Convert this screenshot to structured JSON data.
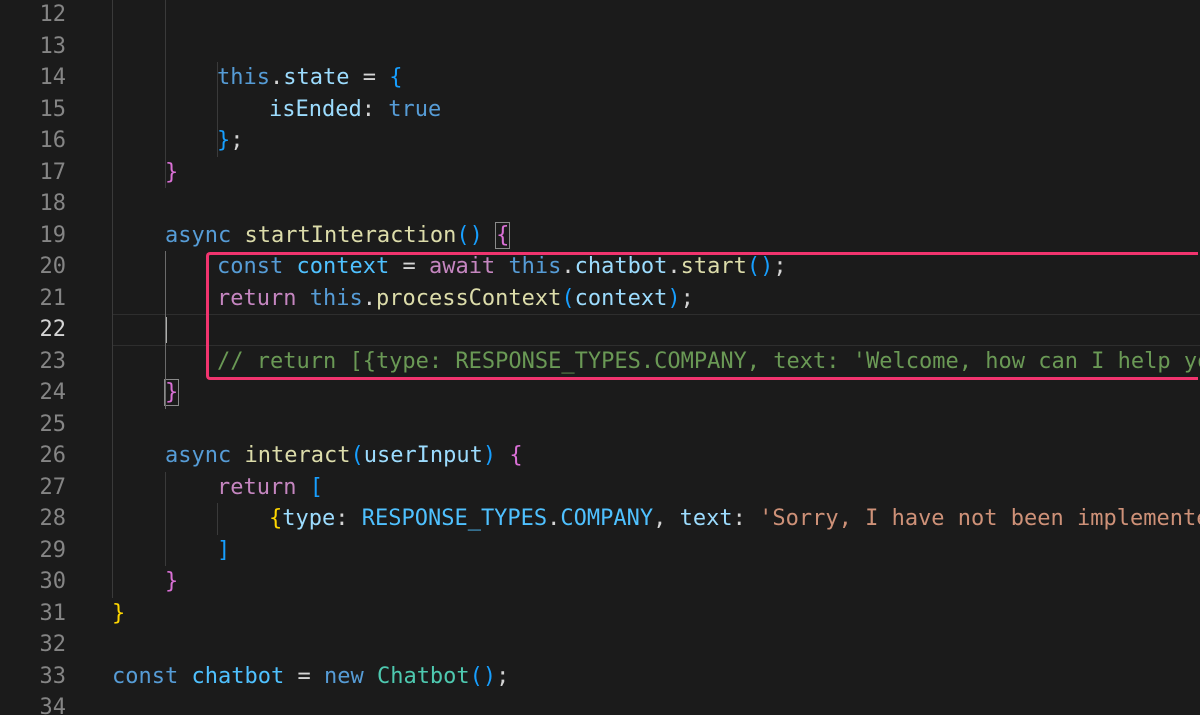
{
  "editor": {
    "active_line": "22",
    "lines": [
      {
        "num": "12",
        "tokens": []
      },
      {
        "num": "13",
        "tokens": []
      },
      {
        "num": "14",
        "tokens": [
          {
            "t": "this",
            "c": "th"
          },
          {
            "t": ".",
            "c": "op"
          },
          {
            "t": "state",
            "c": "prop"
          },
          {
            "t": " = ",
            "c": "op"
          },
          {
            "t": "{",
            "c": "b3"
          }
        ]
      },
      {
        "num": "15",
        "tokens": [
          {
            "t": "isEnded",
            "c": "prop"
          },
          {
            "t": ": ",
            "c": "op"
          },
          {
            "t": "true",
            "c": "kw"
          }
        ]
      },
      {
        "num": "16",
        "tokens": [
          {
            "t": "}",
            "c": "b3"
          },
          {
            "t": ";",
            "c": "op"
          }
        ]
      },
      {
        "num": "17",
        "tokens": [
          {
            "t": "}",
            "c": "b2"
          }
        ]
      },
      {
        "num": "18",
        "tokens": []
      },
      {
        "num": "19",
        "tokens": [
          {
            "t": "async",
            "c": "kw"
          },
          {
            "t": " ",
            "c": "op"
          },
          {
            "t": "startInteraction",
            "c": "fn"
          },
          {
            "t": "()",
            "c": "b3"
          },
          {
            "t": " ",
            "c": "op"
          },
          {
            "t": "{",
            "c": "b2 bracket-box"
          }
        ]
      },
      {
        "num": "20",
        "tokens": [
          {
            "t": "const",
            "c": "kw"
          },
          {
            "t": " ",
            "c": "op"
          },
          {
            "t": "context",
            "c": "var"
          },
          {
            "t": " = ",
            "c": "op"
          },
          {
            "t": "await",
            "c": "kwc"
          },
          {
            "t": " ",
            "c": "op"
          },
          {
            "t": "this",
            "c": "th"
          },
          {
            "t": ".",
            "c": "op"
          },
          {
            "t": "chatbot",
            "c": "prop"
          },
          {
            "t": ".",
            "c": "op"
          },
          {
            "t": "start",
            "c": "fn"
          },
          {
            "t": "()",
            "c": "b3"
          },
          {
            "t": ";",
            "c": "op"
          }
        ]
      },
      {
        "num": "21",
        "tokens": [
          {
            "t": "return",
            "c": "kwc"
          },
          {
            "t": " ",
            "c": "op"
          },
          {
            "t": "this",
            "c": "th"
          },
          {
            "t": ".",
            "c": "op"
          },
          {
            "t": "processContext",
            "c": "fn"
          },
          {
            "t": "(",
            "c": "b3"
          },
          {
            "t": "context",
            "c": "prop"
          },
          {
            "t": ")",
            "c": "b3"
          },
          {
            "t": ";",
            "c": "op"
          }
        ]
      },
      {
        "num": "22",
        "tokens": []
      },
      {
        "num": "23",
        "tokens": [
          {
            "t": "// return [{type: RESPONSE_TYPES.COMPANY, text: 'Welcome, how can I help yo",
            "c": "cmt"
          }
        ]
      },
      {
        "num": "24",
        "tokens": [
          {
            "t": "}",
            "c": "b2 bracket-box"
          }
        ]
      },
      {
        "num": "25",
        "tokens": []
      },
      {
        "num": "26",
        "tokens": [
          {
            "t": "async",
            "c": "kw"
          },
          {
            "t": " ",
            "c": "op"
          },
          {
            "t": "interact",
            "c": "fn"
          },
          {
            "t": "(",
            "c": "b3"
          },
          {
            "t": "userInput",
            "c": "prop"
          },
          {
            "t": ")",
            "c": "b3"
          },
          {
            "t": " ",
            "c": "op"
          },
          {
            "t": "{",
            "c": "b2"
          }
        ]
      },
      {
        "num": "27",
        "tokens": [
          {
            "t": "return",
            "c": "kwc"
          },
          {
            "t": " ",
            "c": "op"
          },
          {
            "t": "[",
            "c": "b3"
          }
        ]
      },
      {
        "num": "28",
        "tokens": [
          {
            "t": "{",
            "c": "b1"
          },
          {
            "t": "type",
            "c": "prop"
          },
          {
            "t": ": ",
            "c": "op"
          },
          {
            "t": "RESPONSE_TYPES",
            "c": "var"
          },
          {
            "t": ".",
            "c": "op"
          },
          {
            "t": "COMPANY",
            "c": "var"
          },
          {
            "t": ", ",
            "c": "op"
          },
          {
            "t": "text",
            "c": "prop"
          },
          {
            "t": ": ",
            "c": "op"
          },
          {
            "t": "'Sorry, I have not been implemented",
            "c": "str"
          }
        ]
      },
      {
        "num": "29",
        "tokens": [
          {
            "t": "]",
            "c": "b3"
          }
        ]
      },
      {
        "num": "30",
        "tokens": [
          {
            "t": "}",
            "c": "b2"
          }
        ]
      },
      {
        "num": "31",
        "tokens": [
          {
            "t": "}",
            "c": "b1"
          }
        ]
      },
      {
        "num": "32",
        "tokens": []
      },
      {
        "num": "33",
        "tokens": [
          {
            "t": "const",
            "c": "kw"
          },
          {
            "t": " ",
            "c": "op"
          },
          {
            "t": "chatbot",
            "c": "var"
          },
          {
            "t": " = ",
            "c": "op"
          },
          {
            "t": "new",
            "c": "kw"
          },
          {
            "t": " ",
            "c": "op"
          },
          {
            "t": "Chatbot",
            "c": "cls"
          },
          {
            "t": "()",
            "c": "b3"
          },
          {
            "t": ";",
            "c": "op"
          }
        ]
      },
      {
        "num": "34",
        "tokens": []
      }
    ]
  },
  "annotation": {
    "highlight_color": "#f0346e",
    "highlight_lines": [
      "20",
      "21",
      "22",
      "23"
    ]
  },
  "colors": {
    "background": "#1b1b1b",
    "line_number": "#858585",
    "keyword": "#569cd6",
    "control": "#c586c0",
    "function": "#dcdcaa",
    "property": "#9cdcfe",
    "variable": "#4fc1ff",
    "class": "#4ec9b0",
    "string": "#ce9178",
    "comment": "#6a9955"
  }
}
